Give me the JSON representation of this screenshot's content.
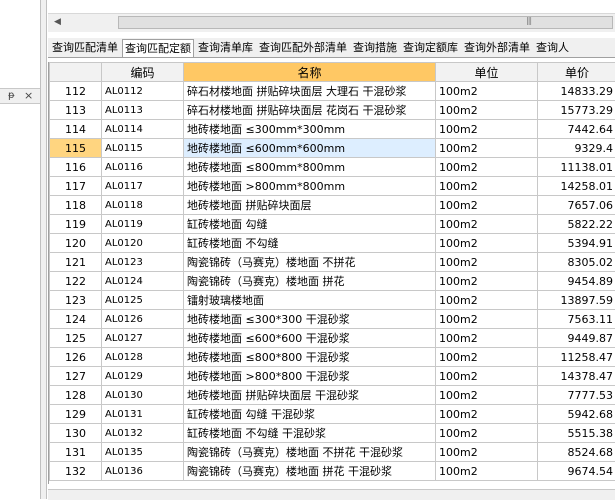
{
  "left_panel": {
    "pin": "ᵽ",
    "close": "×"
  },
  "scrollbar": {
    "left_arrow": "◀",
    "grip": "|||"
  },
  "tabs": [
    {
      "label": "查询匹配清单",
      "active": false
    },
    {
      "label": "查询匹配定额",
      "active": true
    },
    {
      "label": "查询清单库",
      "active": false
    },
    {
      "label": "查询匹配外部清单",
      "active": false
    },
    {
      "label": "查询措施",
      "active": false
    },
    {
      "label": "查询定额库",
      "active": false
    },
    {
      "label": "查询外部清单",
      "active": false
    },
    {
      "label": "查询人",
      "active": false
    }
  ],
  "columns": {
    "index": "",
    "code": "编码",
    "name": "名称",
    "unit": "单位",
    "price": "单价"
  },
  "current_row": "115",
  "rows": [
    {
      "idx": "112",
      "code": "AL0112",
      "name": "碎石材楼地面 拼贴碎块面层 大理石 干混砂浆",
      "unit": "100m2",
      "price": "14833.29"
    },
    {
      "idx": "113",
      "code": "AL0113",
      "name": "碎石材楼地面 拼贴碎块面层 花岗石 干混砂浆",
      "unit": "100m2",
      "price": "15773.29"
    },
    {
      "idx": "114",
      "code": "AL0114",
      "name": "地砖楼地面 ≤300mm*300mm",
      "unit": "100m2",
      "price": "7442.64"
    },
    {
      "idx": "115",
      "code": "AL0115",
      "name": "地砖楼地面 ≤600mm*600mm",
      "unit": "100m2",
      "price": "9329.4"
    },
    {
      "idx": "116",
      "code": "AL0116",
      "name": "地砖楼地面 ≤800mm*800mm",
      "unit": "100m2",
      "price": "11138.01"
    },
    {
      "idx": "117",
      "code": "AL0117",
      "name": "地砖楼地面 >800mm*800mm",
      "unit": "100m2",
      "price": "14258.01"
    },
    {
      "idx": "118",
      "code": "AL0118",
      "name": "地砖楼地面 拼贴碎块面层",
      "unit": "100m2",
      "price": "7657.06"
    },
    {
      "idx": "119",
      "code": "AL0119",
      "name": "缸砖楼地面 勾缝",
      "unit": "100m2",
      "price": "5822.22"
    },
    {
      "idx": "120",
      "code": "AL0120",
      "name": "缸砖楼地面 不勾缝",
      "unit": "100m2",
      "price": "5394.91"
    },
    {
      "idx": "121",
      "code": "AL0123",
      "name": "陶瓷锦砖（马赛克）楼地面 不拼花",
      "unit": "100m2",
      "price": "8305.02"
    },
    {
      "idx": "122",
      "code": "AL0124",
      "name": "陶瓷锦砖（马赛克）楼地面 拼花",
      "unit": "100m2",
      "price": "9454.89"
    },
    {
      "idx": "123",
      "code": "AL0125",
      "name": "镭射玻璃楼地面",
      "unit": "100m2",
      "price": "13897.59"
    },
    {
      "idx": "124",
      "code": "AL0126",
      "name": "地砖楼地面 ≤300*300 干混砂浆",
      "unit": "100m2",
      "price": "7563.11"
    },
    {
      "idx": "125",
      "code": "AL0127",
      "name": "地砖楼地面 ≤600*600 干混砂浆",
      "unit": "100m2",
      "price": "9449.87"
    },
    {
      "idx": "126",
      "code": "AL0128",
      "name": "地砖楼地面 ≤800*800 干混砂浆",
      "unit": "100m2",
      "price": "11258.47"
    },
    {
      "idx": "127",
      "code": "AL0129",
      "name": "地砖楼地面 >800*800 干混砂浆",
      "unit": "100m2",
      "price": "14378.47"
    },
    {
      "idx": "128",
      "code": "AL0130",
      "name": "地砖楼地面 拼贴碎块面层 干混砂浆",
      "unit": "100m2",
      "price": "7777.53"
    },
    {
      "idx": "129",
      "code": "AL0131",
      "name": "缸砖楼地面 勾缝 干混砂浆",
      "unit": "100m2",
      "price": "5942.68"
    },
    {
      "idx": "130",
      "code": "AL0132",
      "name": "缸砖楼地面 不勾缝 干混砂浆",
      "unit": "100m2",
      "price": "5515.38"
    },
    {
      "idx": "131",
      "code": "AL0135",
      "name": "陶瓷锦砖（马赛克）楼地面 不拼花 干混砂浆",
      "unit": "100m2",
      "price": "8524.68"
    },
    {
      "idx": "132",
      "code": "AL0136",
      "name": "陶瓷锦砖（马赛克）楼地面 拼花 干混砂浆",
      "unit": "100m2",
      "price": "9674.54"
    }
  ],
  "colors": {
    "name_header": "#ffc864",
    "current_index": "#ffd580",
    "current_cell": "#ddeeff"
  }
}
